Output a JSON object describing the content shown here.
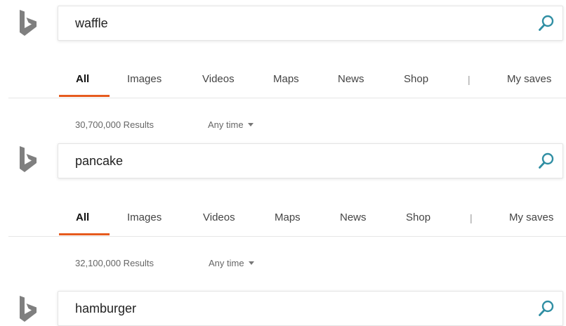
{
  "colors": {
    "accent_underline": "#e65b1e",
    "search_icon": "#2f8ea3",
    "logo_gray": "#7f7f7f"
  },
  "icons": {
    "logo": "bing-logo-icon",
    "search": "search-icon",
    "dropdown": "caret-down-icon"
  },
  "searches": [
    {
      "query": "waffle",
      "tabs": [
        "All",
        "Images",
        "Videos",
        "Maps",
        "News",
        "Shop"
      ],
      "divider": "|",
      "saves": "My saves",
      "results": "30,700,000 Results",
      "filter": "Any time"
    },
    {
      "query": "pancake",
      "tabs": [
        "All",
        "Images",
        "Videos",
        "Maps",
        "News",
        "Shop"
      ],
      "divider": "|",
      "saves": "My saves",
      "results": "32,100,000 Results",
      "filter": "Any time"
    },
    {
      "query": "hamburger"
    }
  ]
}
